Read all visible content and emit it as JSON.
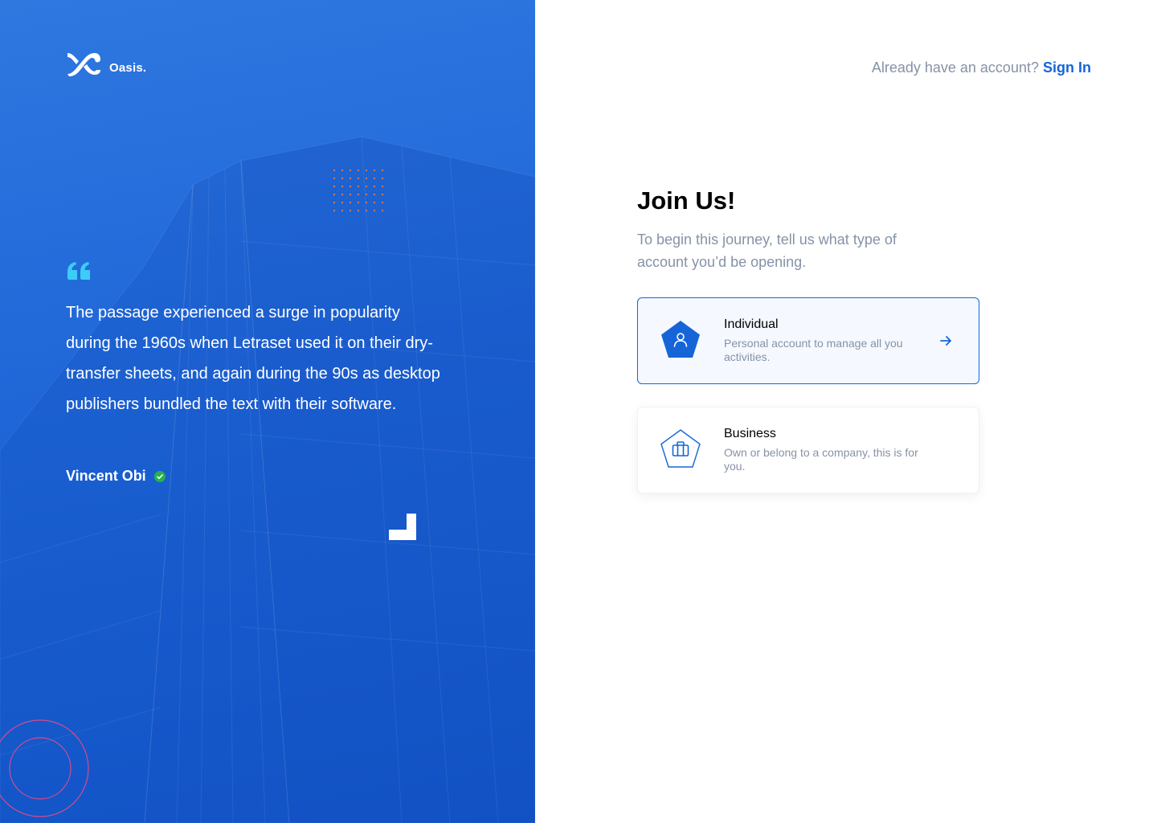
{
  "brand": {
    "name": "Oasis."
  },
  "testimonial": {
    "quote": "The passage experienced a surge in popularity during the 1960s when Letraset used it on their dry-transfer sheets, and again during the 90s as desktop publishers bundled the text with their software.",
    "author": "Vincent Obi"
  },
  "header": {
    "prompt": "Already have an account?",
    "sign_in": "Sign In"
  },
  "main": {
    "title": "Join Us!",
    "subtitle": "To begin this journey, tell us what type of account you’d be opening."
  },
  "options": [
    {
      "title": "Individual",
      "description": "Personal account to manage all you activities.",
      "icon": "user-icon"
    },
    {
      "title": "Business",
      "description": "Own or belong to a company, this is for you.",
      "icon": "briefcase-icon"
    }
  ],
  "colors": {
    "accent": "#1565d8",
    "panel": "#1f66d8",
    "muted": "#8692a6",
    "verified": "#23b24b",
    "quote": "#3ccdf7"
  }
}
